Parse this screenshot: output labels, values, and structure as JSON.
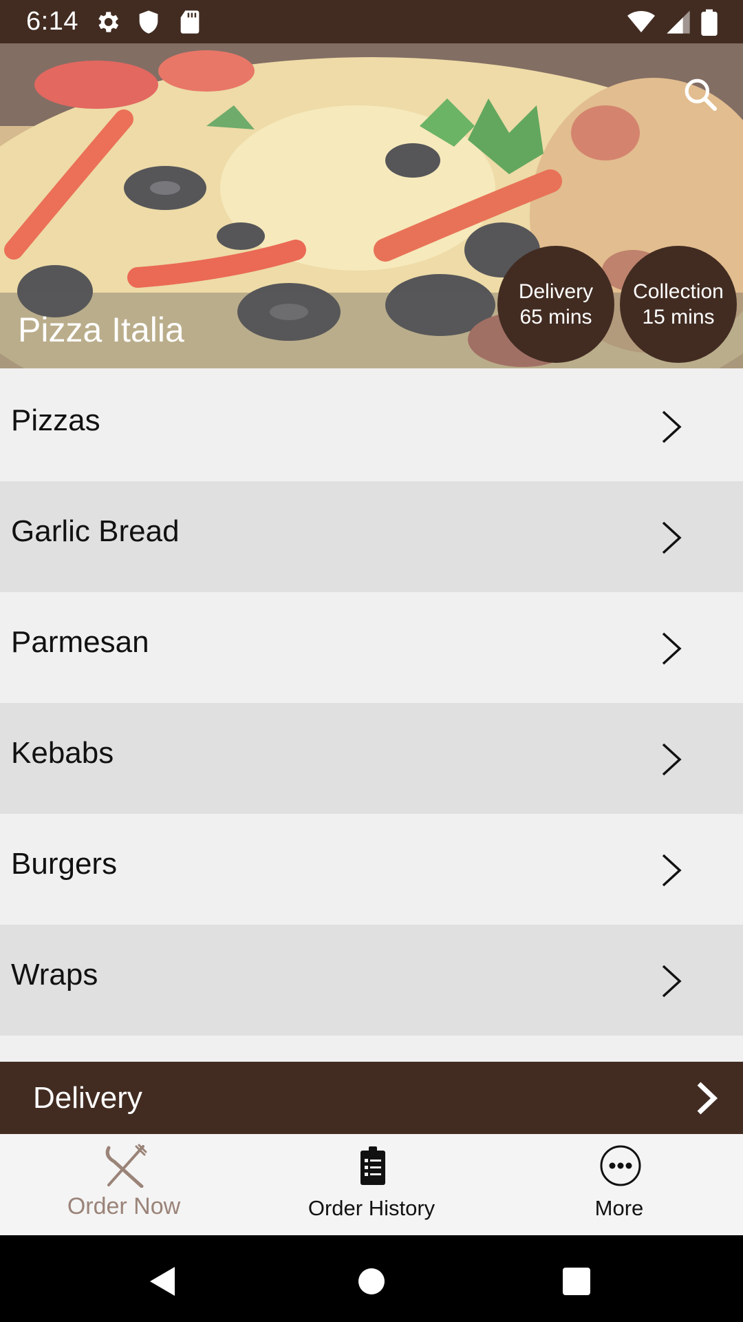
{
  "status_bar": {
    "time": "6:14",
    "icons": [
      "gear-icon",
      "shield-icon",
      "sd-card-icon",
      "wifi-icon",
      "signal-icon",
      "battery-icon"
    ]
  },
  "header": {
    "shop_name": "Pizza Italia",
    "search_icon": "search-icon",
    "delivery": {
      "title": "Delivery",
      "time": "65 mins"
    },
    "collection": {
      "title": "Collection",
      "time": "15 mins"
    }
  },
  "menu": {
    "items": [
      {
        "label": "Pizzas"
      },
      {
        "label": "Garlic Bread"
      },
      {
        "label": "Parmesan"
      },
      {
        "label": "Kebabs"
      },
      {
        "label": "Burgers"
      },
      {
        "label": "Wraps"
      }
    ]
  },
  "delivery_bar": {
    "label": "Delivery"
  },
  "bottom_nav": {
    "tabs": [
      {
        "label": "Order Now",
        "icon": "fork-knife-icon",
        "active": true
      },
      {
        "label": "Order History",
        "icon": "clipboard-icon",
        "active": false
      },
      {
        "label": "More",
        "icon": "more-icon",
        "active": false
      }
    ]
  },
  "colors": {
    "brand": "#422c22",
    "active_tab": "#9a8378",
    "inactive_tab": "#111111"
  }
}
